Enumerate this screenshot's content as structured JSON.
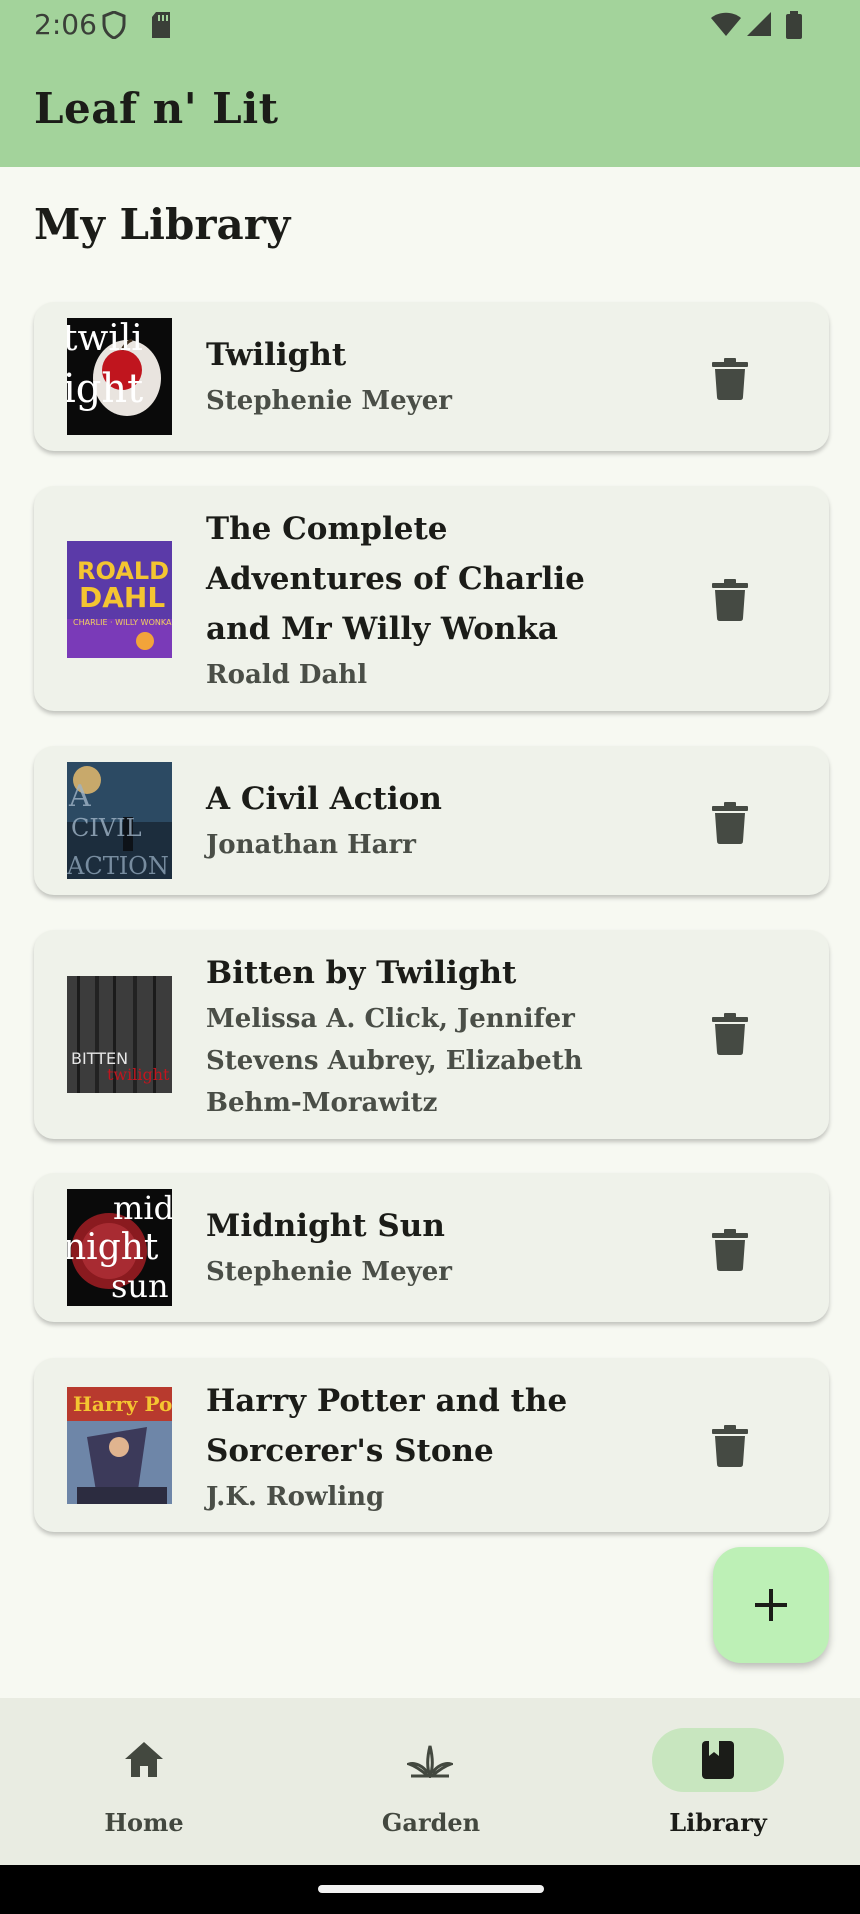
{
  "status_bar": {
    "time": "2:06",
    "icons": [
      "shield-icon",
      "sd-card-icon",
      "wifi-icon",
      "signal-icon",
      "battery-icon"
    ]
  },
  "app_bar": {
    "title": "Leaf n' Lit",
    "background": "#A3D39B"
  },
  "page": {
    "title": "My Library"
  },
  "books": [
    {
      "title": "Twilight",
      "author": "Stephenie Meyer"
    },
    {
      "title": "The Complete Adventures of Charlie and Mr Willy Wonka",
      "author": "Roald Dahl"
    },
    {
      "title": "A Civil Action",
      "author": "Jonathan Harr"
    },
    {
      "title": "Bitten by Twilight",
      "author": "Melissa A. Click, Jennifer Stevens Aubrey, Elizabeth Behm-Morawitz"
    },
    {
      "title": "Midnight Sun",
      "author": "Stephenie Meyer"
    },
    {
      "title": "Harry Potter and the Sorcerer's Stone",
      "author": "J.K. Rowling"
    }
  ],
  "fab": {
    "icon": "plus-icon",
    "color": "#BDF0B6"
  },
  "bottom_nav": {
    "items": [
      {
        "label": "Home",
        "icon": "home-icon",
        "active": false
      },
      {
        "label": "Garden",
        "icon": "sprout-icon",
        "active": false
      },
      {
        "label": "Library",
        "icon": "book-icon",
        "active": true
      }
    ]
  }
}
